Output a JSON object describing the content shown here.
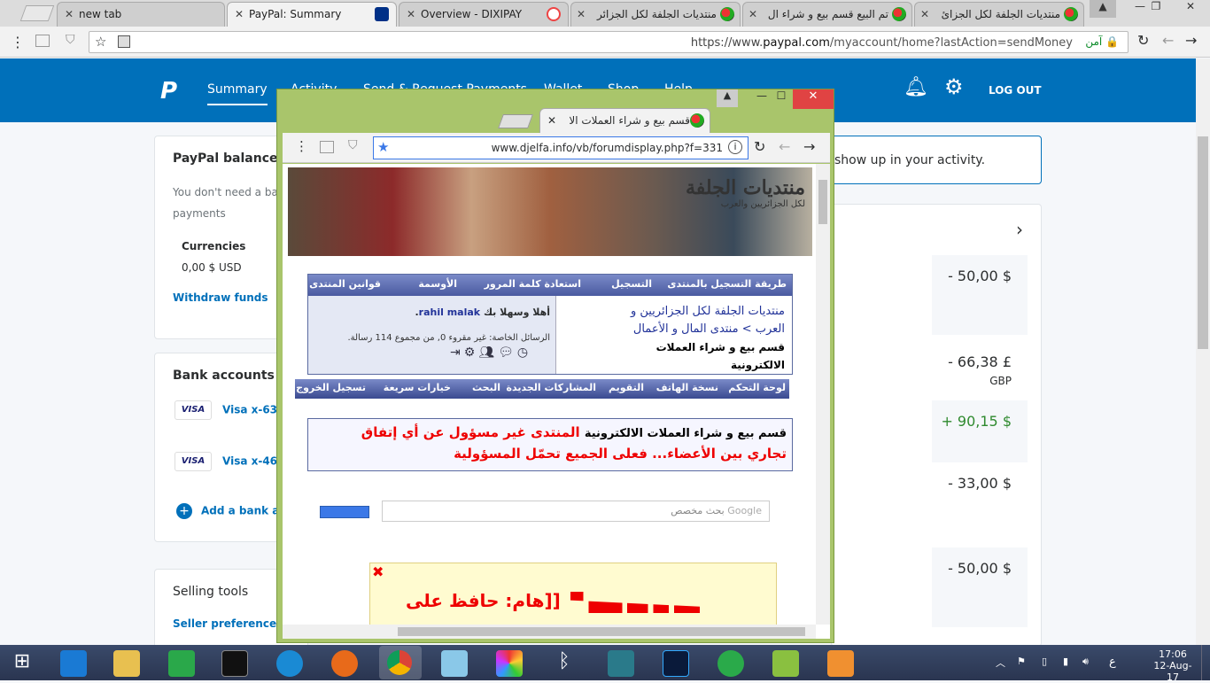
{
  "browser": {
    "tabs": [
      {
        "title": "new tab",
        "active": false
      },
      {
        "title": "PayPal: Summary",
        "active": true
      },
      {
        "title": "Overview - DIXIPAY",
        "active": false
      },
      {
        "title": "منتديات الجلفة لكل الجزائر",
        "active": false
      },
      {
        "title": "تم البيع قسم بيع و شراء ال",
        "active": false
      },
      {
        "title": "منتديات الجلفة لكل الجزائ",
        "active": false
      }
    ],
    "url_prefix": "https://www.",
    "url_host": "paypal.com",
    "url_path": "/myaccount/home?lastAction=sendMoney",
    "secure_label": "آمن"
  },
  "paypal": {
    "nav": [
      "Summary",
      "Activity",
      "Send & Request Payments",
      "Wallet",
      "Shop",
      "Help"
    ],
    "logout": "LOG OUT",
    "balance": {
      "title": "PayPal balance",
      "desc_line1": "You don't need a ba",
      "desc_line2": "payments",
      "currencies_label": "Currencies",
      "currency_value": "0,00 $ USD",
      "withdraw": "Withdraw funds"
    },
    "bank": {
      "title": "Bank accounts a",
      "cards": [
        {
          "brand": "VISA",
          "label": "Visa x-63"
        },
        {
          "brand": "VISA",
          "label": "Visa x-46"
        }
      ],
      "add": "Add a bank a"
    },
    "selling": {
      "title": "Selling tools",
      "link": "Seller preferences"
    },
    "activity_notice": "show up in your activity.",
    "transactions": [
      {
        "amount": "- 50,00 $",
        "sub": "",
        "positive": false
      },
      {
        "amount": "- 66,38 £",
        "sub": "GBP",
        "positive": false
      },
      {
        "amount": "+ 90,15 $",
        "sub": "",
        "positive": true
      },
      {
        "amount": "- 33,00 $",
        "sub": "",
        "positive": false
      },
      {
        "amount": "- 50,00 $",
        "sub": "",
        "positive": false
      }
    ]
  },
  "popup": {
    "tab_title": "قسم بيع و شراء العملات الا",
    "url": "www.djelfa.info/vb/forumdisplay.php?f=331",
    "banner_title": "منتديات الجلفة",
    "banner_sub": "لكل الجزائريين والعرب",
    "nav_links": [
      "طريقة التسجيل بالمنتدى",
      "التسجيل",
      "استعادة كلمة المرور",
      "الأوسمة",
      "قوانين المنتدى"
    ],
    "breadcrumb_1": "منتديات الجلفة لكل الجزائريين و",
    "breadcrumb_2": "العرب > منتدى المال و الأعمال",
    "breadcrumb_3": "قسم بيع و شراء العملات",
    "breadcrumb_4": "الالكترونية",
    "welcome_prefix": "أهلا وسهلا بك",
    "username": "rahil malak",
    "pm_text": "الرسائل الخاصة: غير مقروء 0, من مجموع 114 رسالة.",
    "quick_links": [
      "لوحة التحكم",
      "نسخة الهاتف",
      "التقويم",
      "المشاركات الجديدة",
      "البحث",
      "خيارات سريعة",
      "تسجيل الخروج"
    ],
    "notice_black": "قسم بيع و شراء العملات الالكترونية",
    "notice_red_1": "المنتدى غير مسؤول عن أي إتفاق",
    "notice_red_2": "تجاري بين الأعضاء... فعلى الجميع تحمّل المسؤولية",
    "search_placeholder": "بحث مخصص",
    "search_brand": "Google",
    "warning": "[[هام: حافظ على"
  },
  "taskbar": {
    "time": "17:06",
    "date": "12-Aug-17",
    "lang": "ع"
  }
}
